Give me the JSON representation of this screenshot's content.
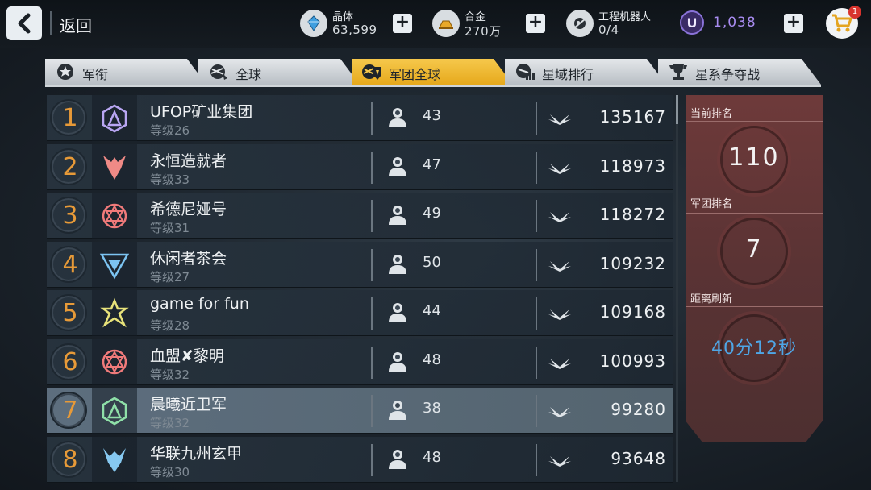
{
  "header": {
    "back_label": "返回",
    "resources": [
      {
        "name": "晶体",
        "value": "63,599",
        "icon": "crystal-icon"
      },
      {
        "name": "合金",
        "value": "270万",
        "icon": "alloy-icon"
      },
      {
        "name": "工程机器人",
        "value": "0/4",
        "icon": "robot-icon"
      }
    ],
    "currency_symbol": "U",
    "currency_value": "1,038",
    "cart_badge": "1"
  },
  "tabs": [
    {
      "label": "军衔",
      "icon": "rank-badge-icon",
      "active": false
    },
    {
      "label": "全球",
      "icon": "globe-icon",
      "active": false
    },
    {
      "label": "军团全球",
      "icon": "legion-globe-icon",
      "active": true
    },
    {
      "label": "星域排行",
      "icon": "star-domain-icon",
      "active": false
    },
    {
      "label": "星系争夺战",
      "icon": "trophy-icon",
      "active": false
    }
  ],
  "rows": [
    {
      "rank": "1",
      "name": "UFOP矿业集团",
      "level": "等级26",
      "members": "43",
      "power": "135167",
      "emblem_color": "#b9a6f2",
      "highlight": false
    },
    {
      "rank": "2",
      "name": "永恒造就者",
      "level": "等级33",
      "members": "47",
      "power": "118973",
      "emblem_color": "#f08a86",
      "highlight": false
    },
    {
      "rank": "3",
      "name": "希德尼娅号",
      "level": "等级31",
      "members": "49",
      "power": "118272",
      "emblem_color": "#f07a7a",
      "highlight": false
    },
    {
      "rank": "4",
      "name": "休闲者茶会",
      "level": "等级27",
      "members": "50",
      "power": "109232",
      "emblem_color": "#7cc4f2",
      "highlight": false
    },
    {
      "rank": "5",
      "name": "game for fun",
      "level": "等级28",
      "members": "44",
      "power": "109168",
      "emblem_color": "#e7e27a",
      "highlight": false
    },
    {
      "rank": "6",
      "name": "血盟✘黎明",
      "level": "等级32",
      "members": "48",
      "power": "100993",
      "emblem_color": "#f07a7a",
      "highlight": false
    },
    {
      "rank": "7",
      "name": "晨曦近卫军",
      "level": "等级32",
      "members": "38",
      "power": "99280",
      "emblem_color": "#8fe0a8",
      "highlight": true
    },
    {
      "rank": "8",
      "name": "华联九州玄甲",
      "level": "等级30",
      "members": "48",
      "power": "93648",
      "emblem_color": "#86c8f0",
      "highlight": false
    }
  ],
  "panel": {
    "current_rank_label": "当前排名",
    "current_rank_value": "110",
    "legion_rank_label": "军团排名",
    "legion_rank_value": "7",
    "refresh_label": "距离刷新",
    "refresh_value": "40分12秒"
  }
}
